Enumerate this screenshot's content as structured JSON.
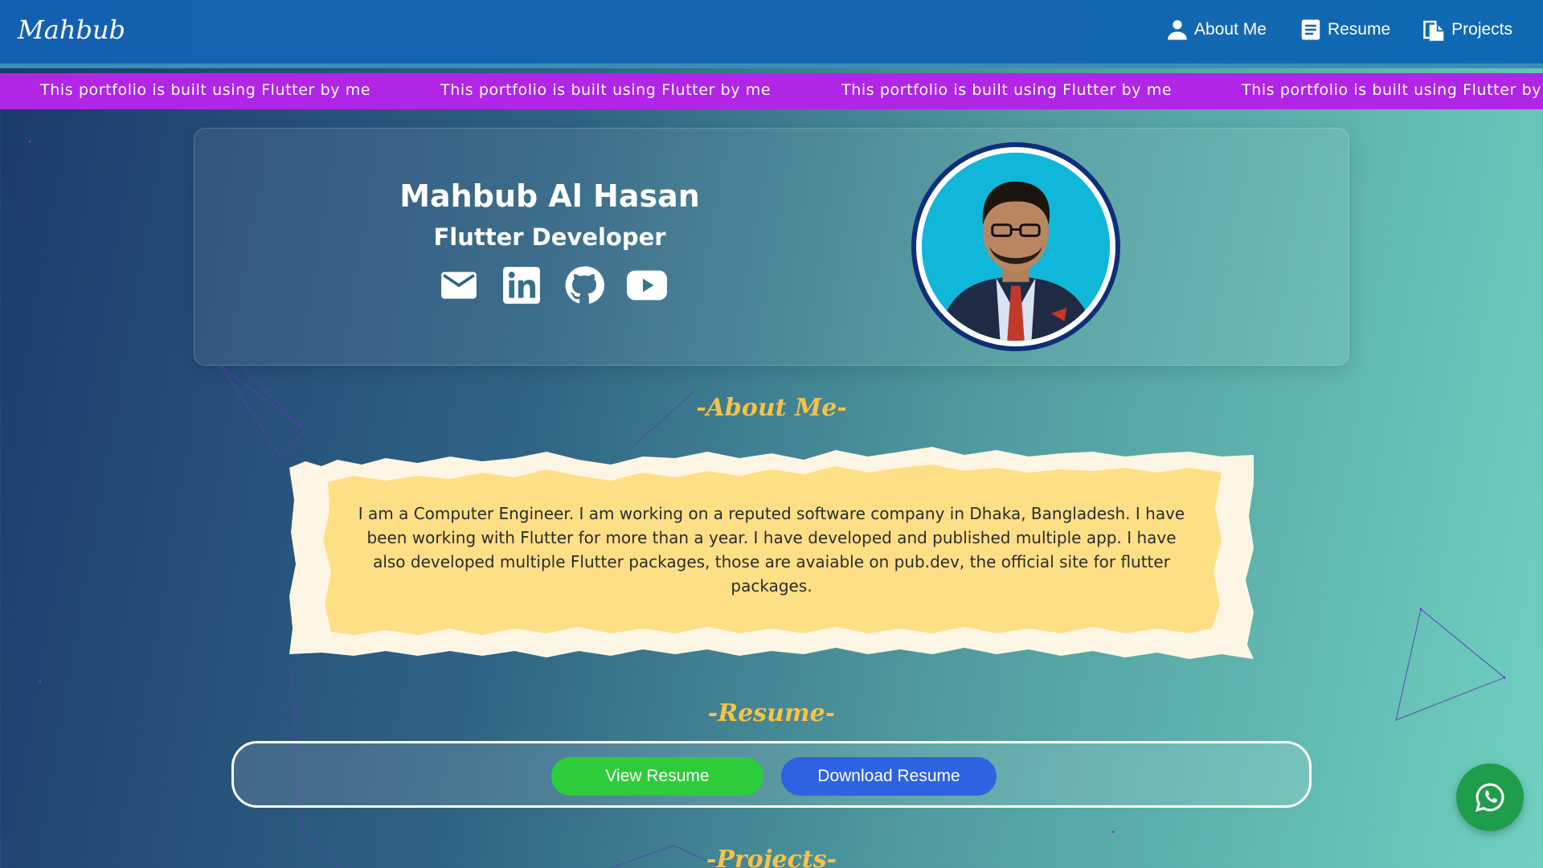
{
  "header": {
    "logo": "Mahbub",
    "nav": [
      {
        "label": "About Me",
        "icon": "person-icon"
      },
      {
        "label": "Resume",
        "icon": "document-icon"
      },
      {
        "label": "Projects",
        "icon": "files-icon"
      }
    ]
  },
  "marquee": {
    "text": "This portfolio is built using Flutter by me",
    "repeat_count": 4
  },
  "profile": {
    "name": "Mahbub Al Hasan",
    "role": "Flutter Developer",
    "socials": [
      "mail-icon",
      "linkedin-icon",
      "github-icon",
      "youtube-icon"
    ]
  },
  "about": {
    "title": "-About Me-",
    "text": "I am a Computer Engineer. I am working on a reputed software company in Dhaka, Bangladesh. I have been working with Flutter for more than a year. I have developed and published multiple app. I have also developed multiple Flutter packages, those are avaiable on pub.dev, the official site for flutter packages."
  },
  "resume": {
    "title": "-Resume-",
    "view_label": "View Resume",
    "download_label": "Download Resume"
  },
  "projects": {
    "title": "-Projects-"
  },
  "colors": {
    "accent_title": "#f5c24a",
    "marquee_bg": "#b125e6",
    "view_button": "#2ecc3a",
    "download_button": "#2d63e0",
    "whatsapp": "#1e9e4b"
  }
}
